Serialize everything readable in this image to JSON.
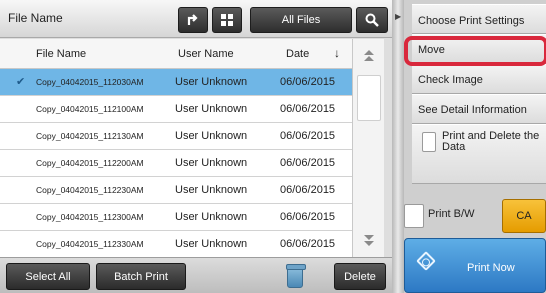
{
  "header": {
    "title": "File Name",
    "all_files_label": "All Files"
  },
  "table": {
    "columns": [
      "File Name",
      "User Name",
      "Date"
    ],
    "rows": [
      {
        "name": "Copy_04042015_112030AM",
        "user": "User Unknown",
        "date": "06/06/2015",
        "selected": true
      },
      {
        "name": "Copy_04042015_112100AM",
        "user": "User Unknown",
        "date": "06/06/2015",
        "selected": false
      },
      {
        "name": "Copy_04042015_112130AM",
        "user": "User Unknown",
        "date": "06/06/2015",
        "selected": false
      },
      {
        "name": "Copy_04042015_112200AM",
        "user": "User Unknown",
        "date": "06/06/2015",
        "selected": false
      },
      {
        "name": "Copy_04042015_112230AM",
        "user": "User Unknown",
        "date": "06/06/2015",
        "selected": false
      },
      {
        "name": "Copy_04042015_112300AM",
        "user": "User Unknown",
        "date": "06/06/2015",
        "selected": false
      },
      {
        "name": "Copy_04042015_112330AM",
        "user": "User Unknown",
        "date": "06/06/2015",
        "selected": false
      }
    ]
  },
  "bottom": {
    "select_all_label": "Select All",
    "batch_print_label": "Batch Print",
    "delete_label": "Delete"
  },
  "sidebar": {
    "items": [
      {
        "label": "Choose Print Settings"
      },
      {
        "label": "Move"
      },
      {
        "label": "Check Image"
      },
      {
        "label": "See Detail Information"
      },
      {
        "label": "Print and Delete the Data"
      }
    ]
  },
  "options": {
    "print_bw_label": "Print B/W",
    "ca_label": "CA",
    "print_now_label": "Print Now"
  },
  "colors": {
    "selected_row": "#6fb6e6",
    "highlight": "#d9283c",
    "ca_button": "#f0ac14",
    "print_now": "#3f8fd4"
  },
  "icons": {
    "sort": "down-arrow-icon",
    "up_folder": "up-folder-icon",
    "grid": "grid-view-icon",
    "search": "search-icon",
    "trash": "trash-icon",
    "start": "start-icon"
  }
}
